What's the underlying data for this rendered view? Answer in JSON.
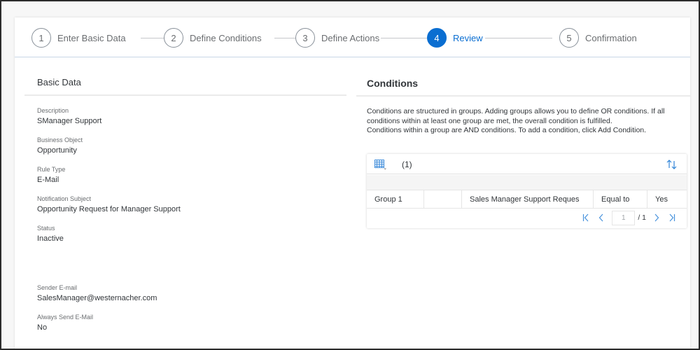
{
  "wizard": {
    "steps": [
      {
        "number": "1",
        "label": "Enter Basic Data",
        "state": "completed"
      },
      {
        "number": "2",
        "label": "Define Conditions",
        "state": "completed"
      },
      {
        "number": "3",
        "label": "Define Actions",
        "state": "completed"
      },
      {
        "number": "4",
        "label": "Review",
        "state": "active"
      },
      {
        "number": "5",
        "label": "Confirmation",
        "state": "upcoming"
      }
    ],
    "active_color": "#0a6ed1"
  },
  "basic_data": {
    "title": "Basic Data",
    "fields": [
      {
        "label": "Description",
        "value": "SManager Support"
      },
      {
        "label": "Business Object",
        "value": "Opportunity"
      },
      {
        "label": "Rule Type",
        "value": "E-Mail"
      },
      {
        "label": "Notification Subject",
        "value": "Opportunity Request for Manager Support"
      },
      {
        "label": "Status",
        "value": "Inactive"
      },
      {
        "label": "Sender E-mail",
        "value": "SalesManager@westernacher.com"
      },
      {
        "label": "Always Send E-Mail",
        "value": "No"
      }
    ]
  },
  "conditions": {
    "title": "Conditions",
    "description_lines": [
      "Conditions are structured in groups. Adding groups allows you to define OR conditions. If all",
      "conditions within at least one group are met, the overall condition is fulfilled.",
      "Conditions within a group are AND conditions. To add a condition, click Add Condition."
    ],
    "table": {
      "row_count": "(1)",
      "toolbar_icons": [
        "table-settings-icon",
        "sort-icon"
      ],
      "rows": [
        {
          "group": "Group 1",
          "blank": "",
          "attribute": "Sales Manager Support Reques",
          "operator": "Equal to",
          "value": "Yes"
        }
      ],
      "pagination": {
        "current_page": "1",
        "total_label": "/ 1",
        "buttons": [
          "first-page",
          "previous-page",
          "next-page",
          "last-page"
        ]
      }
    }
  }
}
